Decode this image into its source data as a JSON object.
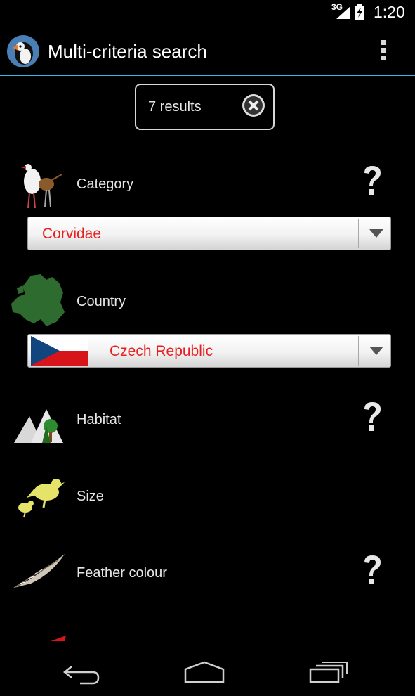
{
  "status_bar": {
    "network": "3G",
    "time": "1:20"
  },
  "action_bar": {
    "title": "Multi-criteria search",
    "app_icon": "puffin-icon",
    "menu_icon": "overflow-menu-icon"
  },
  "results": {
    "text": "7 results",
    "clear_icon": "clear-icon"
  },
  "criteria": [
    {
      "label": "Category",
      "icon": "bird-category-icon",
      "has_help": true,
      "selected": "Corvidae"
    },
    {
      "label": "Country",
      "icon": "europe-map-icon",
      "has_help": false,
      "selected": "Czech Republic",
      "flag": "czech-flag"
    },
    {
      "label": "Habitat",
      "icon": "mountain-tree-icon",
      "has_help": true
    },
    {
      "label": "Size",
      "icon": "bird-size-icon",
      "has_help": false
    },
    {
      "label": "Feather colour",
      "icon": "feather-icon",
      "has_help": true
    }
  ],
  "nav_bar": {
    "back": "back-icon",
    "home": "home-icon",
    "recents": "recent-apps-icon"
  },
  "colors": {
    "accent": "#33b5e5",
    "spinner_text": "#e8201f",
    "background": "#000000"
  }
}
